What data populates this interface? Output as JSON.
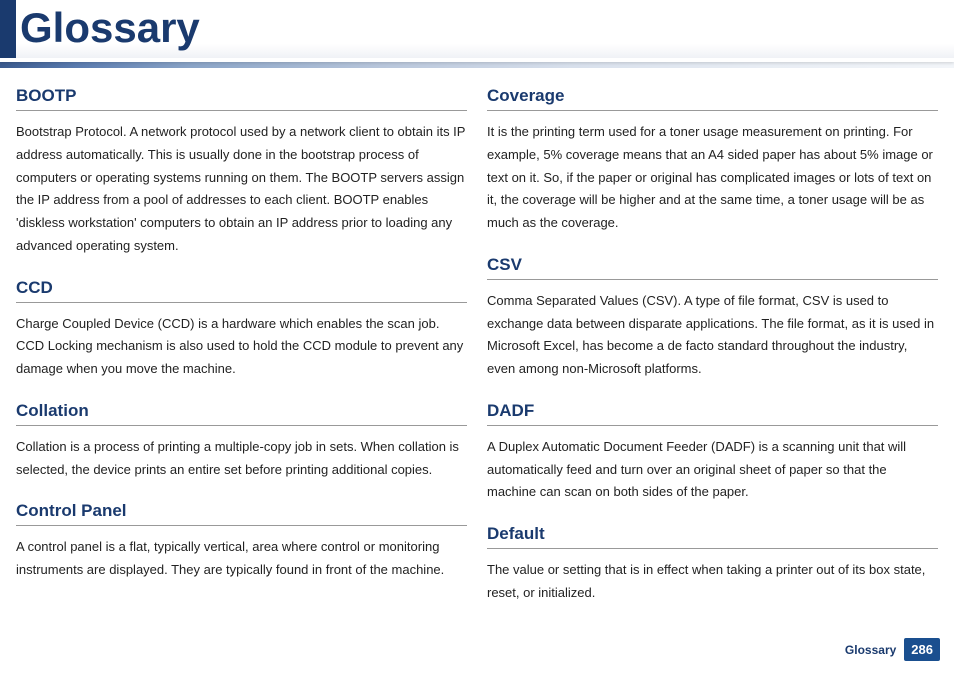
{
  "header": {
    "title": "Glossary"
  },
  "left": {
    "entries": [
      {
        "term": "BOOTP",
        "def": "Bootstrap Protocol. A network protocol used by a network client to obtain its IP address automatically. This is usually done in the bootstrap process of computers or operating systems running on them. The BOOTP servers assign the IP address from a pool of addresses to each client. BOOTP enables 'diskless workstation' computers to obtain an IP address prior to loading any advanced operating system."
      },
      {
        "term": "CCD",
        "def": "Charge Coupled Device (CCD) is a hardware which enables the scan job. CCD Locking mechanism is also used to hold the CCD module to prevent any damage when you move the machine."
      },
      {
        "term": "Collation",
        "def": "Collation is a process of printing a multiple-copy job in sets. When collation is selected, the device prints an entire set before printing additional copies."
      },
      {
        "term": "Control Panel",
        "def": "A control panel is a flat, typically vertical, area where control or monitoring instruments are displayed. They are typically found in front of the machine."
      }
    ]
  },
  "right": {
    "entries": [
      {
        "term": "Coverage",
        "def": "It is the printing term used for a toner usage measurement on printing. For example, 5% coverage means that an A4 sided paper has about 5% image or text on it. So, if the paper or original has complicated images or lots of text on it, the coverage will be higher and at the same time, a toner usage will be as much as the coverage."
      },
      {
        "term": "CSV",
        "def": "Comma Separated Values (CSV). A type of file format, CSV is used to exchange data between disparate applications. The file format, as it is used in Microsoft Excel, has become a de facto standard throughout the industry, even among non-Microsoft platforms."
      },
      {
        "term": "DADF",
        "def": "A Duplex Automatic Document Feeder (DADF) is a scanning unit that will automatically feed and turn over an original sheet of paper so that the machine can scan on both sides of the paper."
      },
      {
        "term": "Default",
        "def": "The value or setting that is in effect when taking a printer out of its box state, reset, or initialized."
      }
    ]
  },
  "footer": {
    "label": "Glossary",
    "page": "286"
  }
}
